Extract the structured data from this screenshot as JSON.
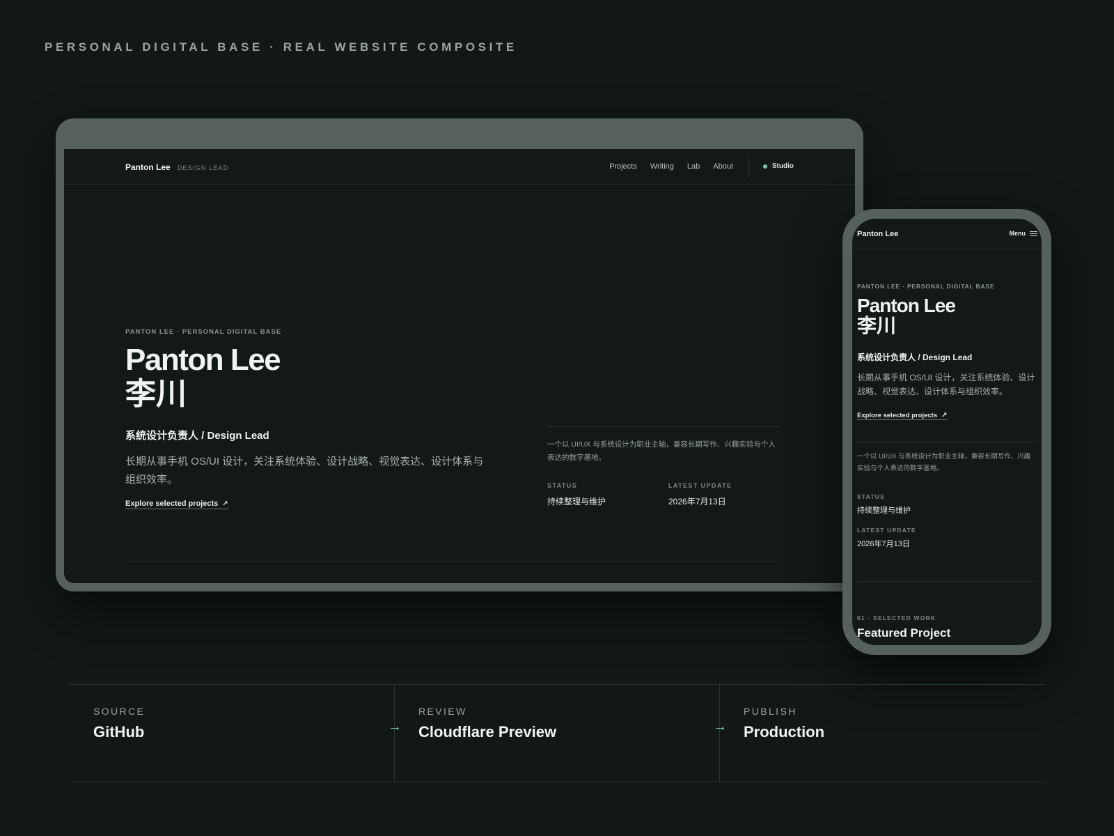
{
  "header": {
    "kicker": "PERSONAL DIGITAL BASE · REAL WEBSITE COMPOSITE"
  },
  "colors": {
    "background": "#111817",
    "frame": "#56605c",
    "accent": "#7fc6a8",
    "screen": "#121918"
  },
  "desktop": {
    "nav": {
      "brand_name": "Panton Lee",
      "brand_role": "DESIGN LEAD",
      "links": [
        "Projects",
        "Writing",
        "Lab",
        "About"
      ],
      "studio_label": "Studio"
    },
    "hero": {
      "eyebrow": "PANTON LEE · PERSONAL DIGITAL BASE",
      "title": "Panton Lee",
      "title_cn": "李川",
      "role": "系统设计负责人 / Design Lead",
      "description": "长期从事手机 OS/UI 设计，关注系统体验、设计战略、视觉表达、设计体系与组织效率。",
      "cta": "Explore selected projects"
    },
    "panel": {
      "text": "一个以 UI/UX 与系统设计为职业主轴，兼容长期写作、兴趣实验与个人表达的数字基地。",
      "status_label": "STATUS",
      "status_value": "持续整理与维护",
      "update_label": "LATEST UPDATE",
      "update_value": "2026年7月13日"
    }
  },
  "mobile": {
    "nav": {
      "brand_name": "Panton Lee",
      "menu_label": "Menu"
    },
    "hero": {
      "eyebrow": "PANTON LEE · PERSONAL DIGITAL BASE",
      "title": "Panton Lee",
      "title_cn": "李川",
      "role": "系统设计负责人 / Design Lead",
      "description": "长期从事手机 OS/UI 设计，关注系统体验、设计战略、视觉表达、设计体系与组织效率。",
      "cta": "Explore selected projects"
    },
    "panel": {
      "text": "一个以 UI/UX 与系统设计为职业主轴，兼容长期写作、兴趣实验与个人表达的数字基地。",
      "status_label": "STATUS",
      "status_value": "持续整理与维护",
      "update_label": "LATEST UPDATE",
      "update_value": "2026年7月13日"
    },
    "work": {
      "label": "01 · SELECTED WORK",
      "title": "Featured Project"
    }
  },
  "pipeline": {
    "stages": [
      {
        "label": "SOURCE",
        "name": "GitHub"
      },
      {
        "label": "REVIEW",
        "name": "Cloudflare Preview"
      },
      {
        "label": "PUBLISH",
        "name": "Production"
      }
    ]
  }
}
